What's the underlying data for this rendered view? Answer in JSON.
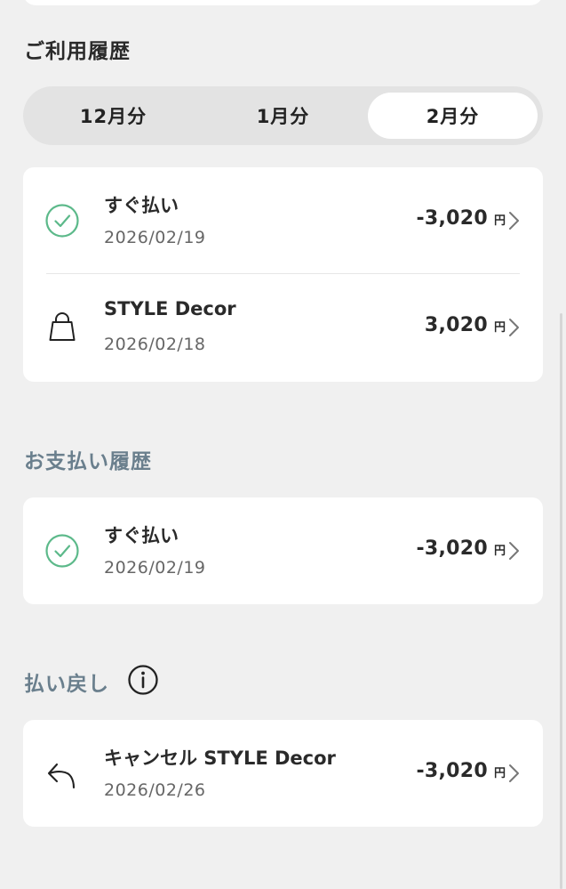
{
  "usage_history": {
    "title": "ご利用履歴",
    "tabs": [
      {
        "label": "12月分",
        "active": false
      },
      {
        "label": "1月分",
        "active": false
      },
      {
        "label": "2月分",
        "active": true
      }
    ],
    "items": [
      {
        "icon": "check-circle-icon",
        "title": "すぐ払い",
        "date": "2026/02/19",
        "amount": "-3,020",
        "unit": "円"
      },
      {
        "icon": "shopping-bag-icon",
        "title": "STYLE Decor",
        "date": "2026/02/18",
        "amount": "3,020",
        "unit": "円"
      }
    ]
  },
  "payment_history": {
    "title": "お支払い履歴",
    "items": [
      {
        "icon": "check-circle-icon",
        "title": "すぐ払い",
        "date": "2026/02/19",
        "amount": "-3,020",
        "unit": "円"
      }
    ]
  },
  "refund": {
    "title": "払い戻し",
    "info_icon": "info-icon",
    "items": [
      {
        "icon": "undo-arrow-icon",
        "title": "キャンセル STYLE Decor",
        "date": "2026/02/26",
        "amount": "-3,020",
        "unit": "円"
      }
    ]
  },
  "colors": {
    "success_green": "#5cb98a",
    "muted_heading": "#6a7f8d",
    "background": "#f0f0f0"
  }
}
